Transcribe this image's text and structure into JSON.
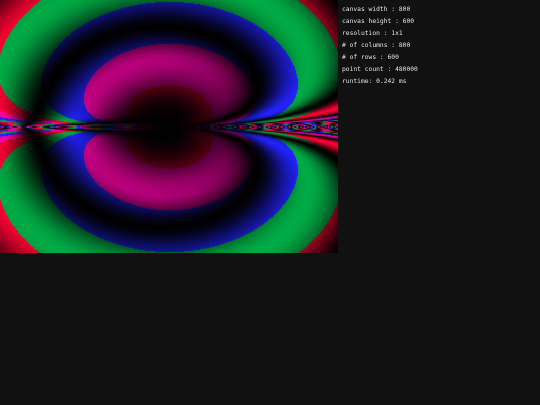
{
  "stats": {
    "canvas_width": "canvas width : 800",
    "canvas_height": "canvas height : 600",
    "resolution": "resolution : 1x1",
    "columns": "# of columns : 800",
    "rows": "# of rows : 600",
    "point_count": "point count : 480000",
    "runtime": "runtime: 0.242 ms"
  },
  "colors": {
    "background": "#111111",
    "text": "#e6e6e6",
    "palette": [
      "#ff0033",
      "#ff00aa",
      "#2222ff",
      "#00aa44",
      "#000000"
    ]
  }
}
